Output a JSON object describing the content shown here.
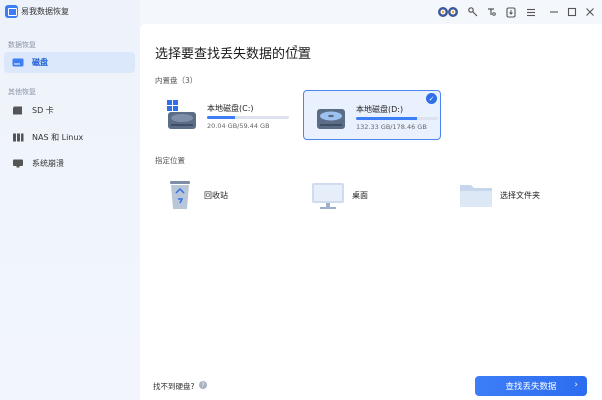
{
  "app": {
    "title": "易我数据恢复"
  },
  "sidebar": {
    "section_local": "数据恢复",
    "section_other": "其他恢复",
    "items": [
      {
        "label": "磁盘"
      },
      {
        "label": "SD 卡"
      },
      {
        "label": "NAS 和 Linux"
      },
      {
        "label": "系统崩溃"
      }
    ]
  },
  "main": {
    "heading": "选择要查找丢失数据的位置",
    "internal_label": "内置盘（3）",
    "disks": [
      {
        "name": "本地磁盘(C:)",
        "size": "20.04 GB/59.44 GB",
        "used": 0.34,
        "selected": false
      },
      {
        "name": "本地磁盘(D:)",
        "size": "132.33 GB/178.46 GB",
        "used": 0.74,
        "selected": true
      }
    ],
    "specified_label": "指定位置",
    "locations": [
      {
        "label": "回收站"
      },
      {
        "label": "桌面"
      },
      {
        "label": "选择文件夹"
      }
    ]
  },
  "footer": {
    "no_disk": "找不到硬盘?",
    "help": "?",
    "scan_button": "查找丢失数据"
  },
  "colors": {
    "accent": "#3d7ef7",
    "sidebar_active": "#dbe7fb"
  },
  "icons": {
    "refresh": "↻",
    "check": "✓",
    "arrow": "›"
  }
}
